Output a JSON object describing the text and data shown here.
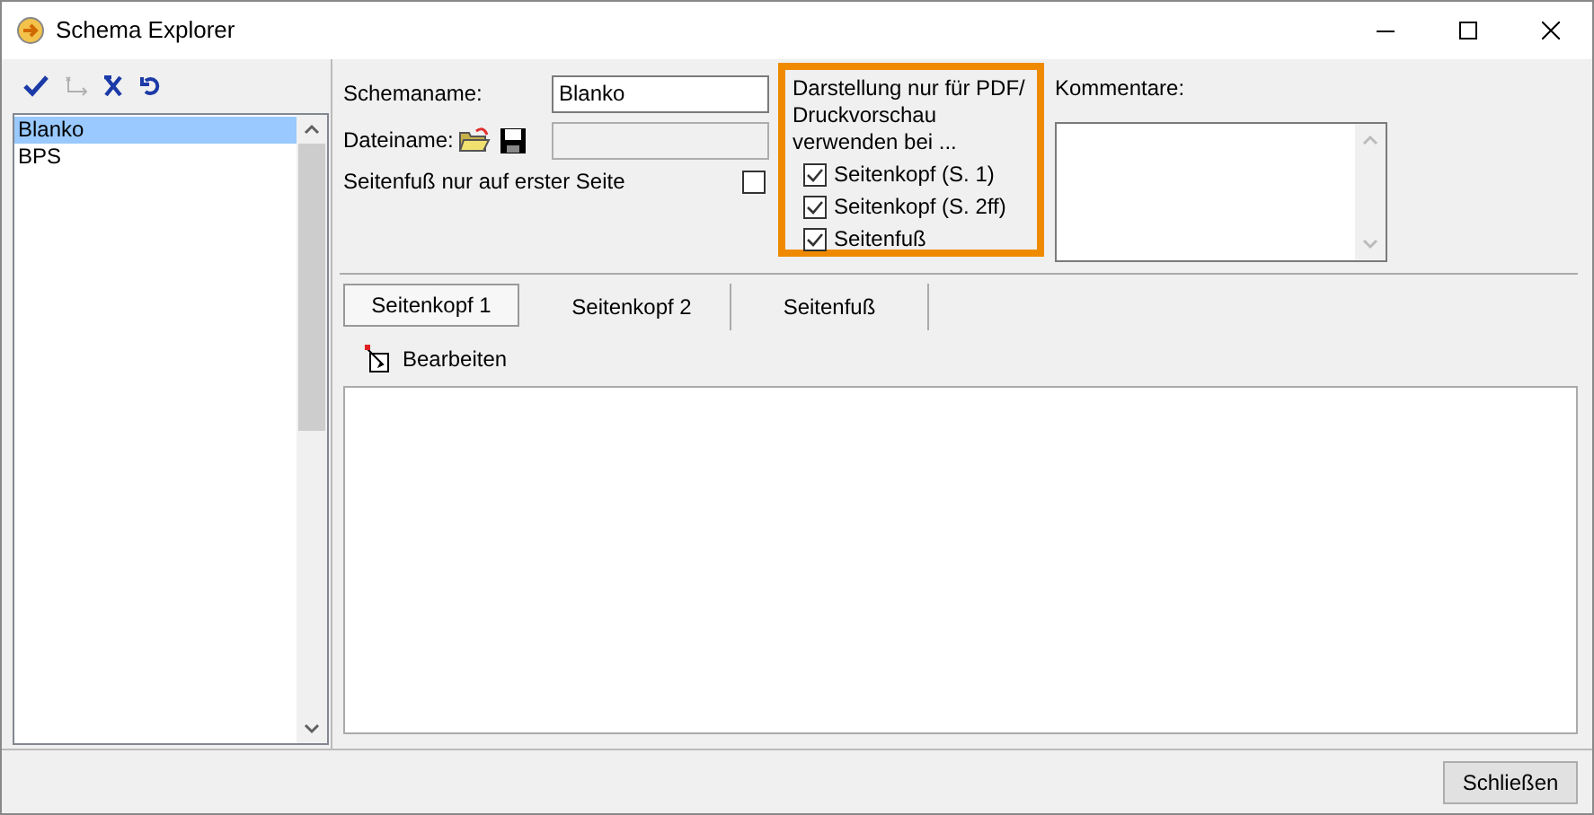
{
  "window": {
    "title": "Schema Explorer"
  },
  "toolbar": [
    {
      "kind": "confirm",
      "disabled": false
    },
    {
      "kind": "new",
      "disabled": true
    },
    {
      "kind": "delete",
      "disabled": false
    },
    {
      "kind": "undo",
      "disabled": false
    }
  ],
  "schema_list": [
    {
      "label": "Blanko",
      "selected": true
    },
    {
      "label": "BPS",
      "selected": false
    }
  ],
  "form": {
    "schemaname_label": "Schemaname:",
    "schemaname_value": "Blanko",
    "dateiname_label": "Dateiname:",
    "footer_first_page": {
      "label": "Seitenfuß nur auf erster Seite",
      "checked": false
    }
  },
  "pdf_group": {
    "title": "Darstellung nur für PDF/ Druckvorschau verwenden bei ...",
    "options": [
      {
        "label": "Seitenkopf (S. 1)",
        "checked": true
      },
      {
        "label": "Seitenkopf (S. 2ff)",
        "checked": true
      },
      {
        "label": "Seitenfuß",
        "checked": true
      }
    ]
  },
  "comments": {
    "label": "Kommentare:"
  },
  "tabs": [
    {
      "label": "Seitenkopf 1",
      "selected": true
    },
    {
      "label": "Seitenkopf 2",
      "selected": false
    },
    {
      "label": "Seitenfuß",
      "selected": false
    }
  ],
  "edit_button": "Bearbeiten",
  "close_button": "Schließen"
}
